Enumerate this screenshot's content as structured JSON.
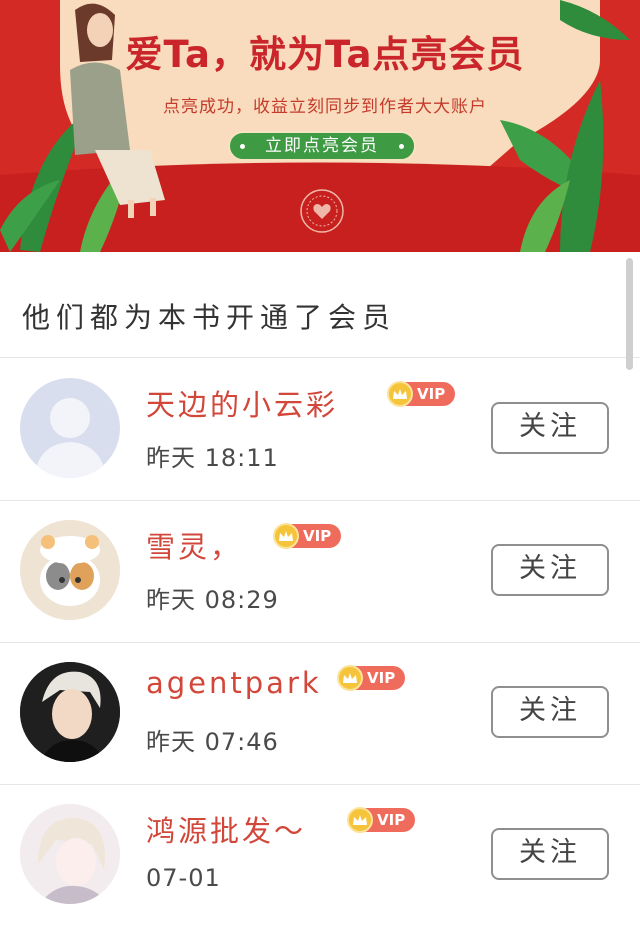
{
  "banner": {
    "title": "爱Ta，就为Ta点亮会员",
    "subtitle": "点亮成功，收益立刻同步到作者大大账户",
    "cta_label": "立即点亮会员"
  },
  "section": {
    "title": "他们都为本书开通了会员"
  },
  "members": [
    {
      "name": "天边的小云彩",
      "vip": "VIP",
      "time": "昨天 18:11",
      "follow": "关注"
    },
    {
      "name": "雪灵，",
      "vip": "VIP",
      "time": "昨天 08:29",
      "follow": "关注"
    },
    {
      "name": "agentpark",
      "vip": "VIP",
      "time": "昨天 07:46",
      "follow": "关注"
    },
    {
      "name": "鸿源批发～",
      "vip": "VIP",
      "time": "07-01",
      "follow": "关注"
    }
  ],
  "colors": {
    "banner_red": "#d42a25",
    "name_red": "#d2473a",
    "vip_badge": "#ef6b5c",
    "cta_green": "#3e9a43"
  },
  "icons": [
    "crown-icon",
    "heart-seal-icon",
    "default-avatar-icon"
  ]
}
